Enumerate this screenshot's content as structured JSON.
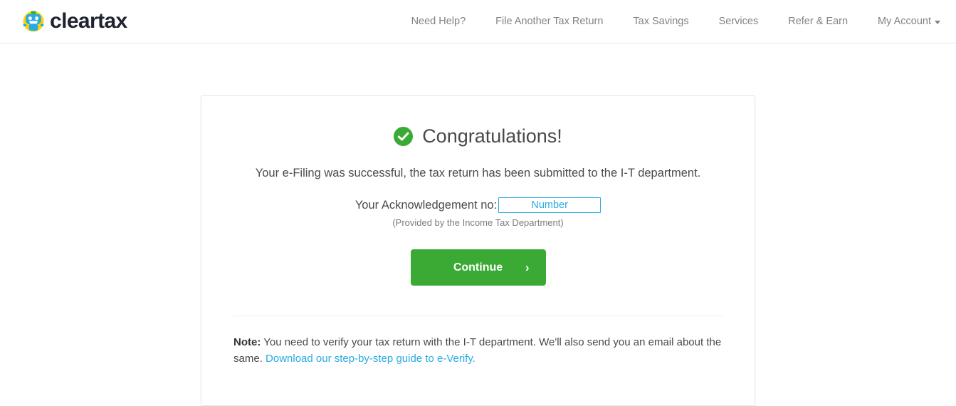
{
  "header": {
    "brand": {
      "wordmark": "cleartax",
      "logo_icon": "cleartax-robot-logo",
      "colors": {
        "wordmark": "#1e2330",
        "robot_body": "#29abe2",
        "robot_halo": "#ffd400",
        "robot_cap": "#3aaa35"
      }
    },
    "nav": [
      {
        "id": "need-help",
        "label": "Need Help?"
      },
      {
        "id": "file-another-tax-return",
        "label": "File Another Tax Return"
      },
      {
        "id": "tax-savings",
        "label": "Tax Savings"
      },
      {
        "id": "services",
        "label": "Services"
      },
      {
        "id": "refer-and-earn",
        "label": "Refer & Earn"
      },
      {
        "id": "my-account",
        "label": "My Account",
        "has_caret": true
      }
    ]
  },
  "card": {
    "status_icon": "success-check-circle-icon",
    "title": "Congratulations!",
    "success_message": "Your e-Filing was successful, the tax return has been submitted to the I-T department.",
    "acknowledgement": {
      "label": "Your Acknowledgement no:",
      "value": "Number",
      "sub_text": "(Provided by the Income Tax Department)"
    },
    "cta": {
      "label": "Continue",
      "chevron": "›"
    },
    "note": {
      "label": "Note:",
      "text": " You need to verify your tax return with the I-T department. We'll also send you an email about the same. ",
      "link_text": "Download our step-by-step guide to e-Verify."
    }
  },
  "colors": {
    "accent_green": "#3aaa35",
    "accent_blue": "#29abe2",
    "text_muted": "#808285",
    "border": "#e6e6e6"
  }
}
